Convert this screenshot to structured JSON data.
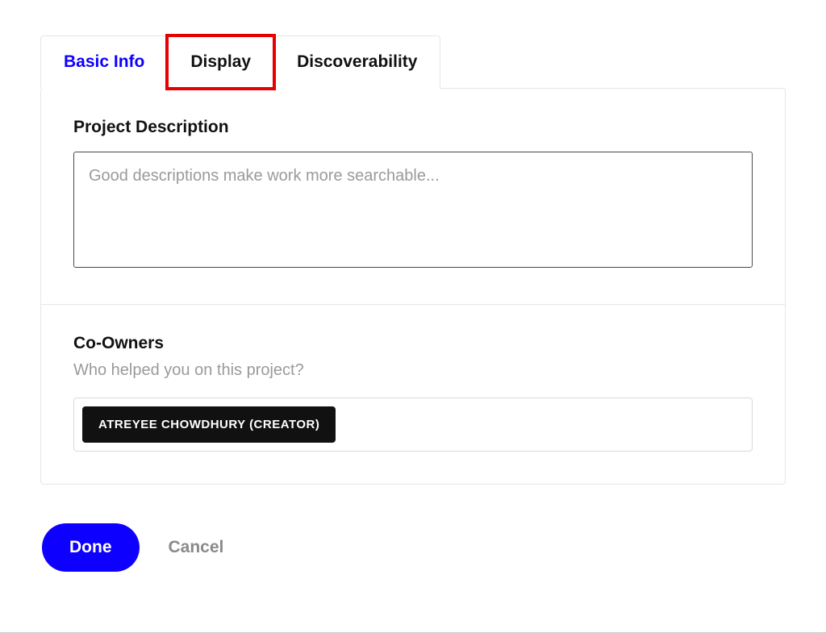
{
  "tabs": [
    {
      "label": "Basic Info",
      "active": true,
      "highlighted": false
    },
    {
      "label": "Display",
      "active": false,
      "highlighted": true
    },
    {
      "label": "Discoverability",
      "active": false,
      "highlighted": false
    }
  ],
  "description": {
    "title": "Project Description",
    "placeholder": "Good descriptions make work more searchable...",
    "value": ""
  },
  "coOwners": {
    "title": "Co-Owners",
    "subtitle": "Who helped you on this project?",
    "chips": [
      "ATREYEE CHOWDHURY (CREATOR)"
    ]
  },
  "buttons": {
    "done": "Done",
    "cancel": "Cancel"
  }
}
